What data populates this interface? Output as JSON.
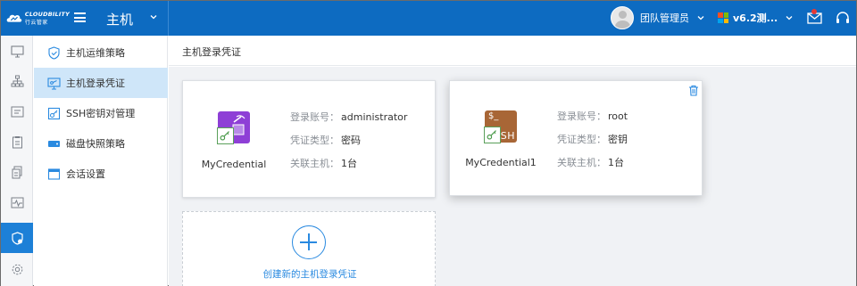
{
  "header": {
    "logo_en": "CLOUDBILITY",
    "logo_cn": "行云管家",
    "title": "主机",
    "user_name": "团队管理员",
    "version": "v6.2测..."
  },
  "rail": {
    "items": [
      {
        "icon": "monitor-icon"
      },
      {
        "icon": "org-chart-icon"
      },
      {
        "icon": "list-panel-icon"
      },
      {
        "icon": "clipboard-icon"
      },
      {
        "icon": "document-copy-icon"
      },
      {
        "icon": "activity-monitor-icon"
      },
      {
        "icon": "shield-settings-icon",
        "active": true
      },
      {
        "icon": "gear-icon"
      }
    ]
  },
  "subnav": {
    "items": [
      {
        "label": "主机运维策略",
        "icon": "shield-check-icon"
      },
      {
        "label": "主机登录凭证",
        "icon": "credential-monitor-icon",
        "active": true
      },
      {
        "label": "SSH密钥对管理",
        "icon": "ssh-key-icon"
      },
      {
        "label": "磁盘快照策略",
        "icon": "disk-icon"
      },
      {
        "label": "会话设置",
        "icon": "window-icon"
      }
    ]
  },
  "breadcrumb": "主机登录凭证",
  "credentials": [
    {
      "name": "MyCredential",
      "fields": [
        {
          "key": "登录账号：",
          "value": "administrator"
        },
        {
          "key": "凭证类型：",
          "value": "密码"
        },
        {
          "key": "关联主机：",
          "value": "1台"
        }
      ]
    },
    {
      "name": "MyCredential1",
      "icon_text": "SH",
      "icon_prompt": "$_",
      "fields": [
        {
          "key": "登录账号：",
          "value": "root"
        },
        {
          "key": "凭证类型：",
          "value": "密钥"
        },
        {
          "key": "关联主机：",
          "value": "1台"
        }
      ]
    }
  ],
  "create": {
    "label": "创建新的主机登录凭证"
  },
  "colors": {
    "topbar": "#0d6bc1",
    "accent": "#1d80d7",
    "subnav_active": "#cfe6f9",
    "password_icon": "#8e3fd6",
    "key_icon": "#a86636"
  }
}
